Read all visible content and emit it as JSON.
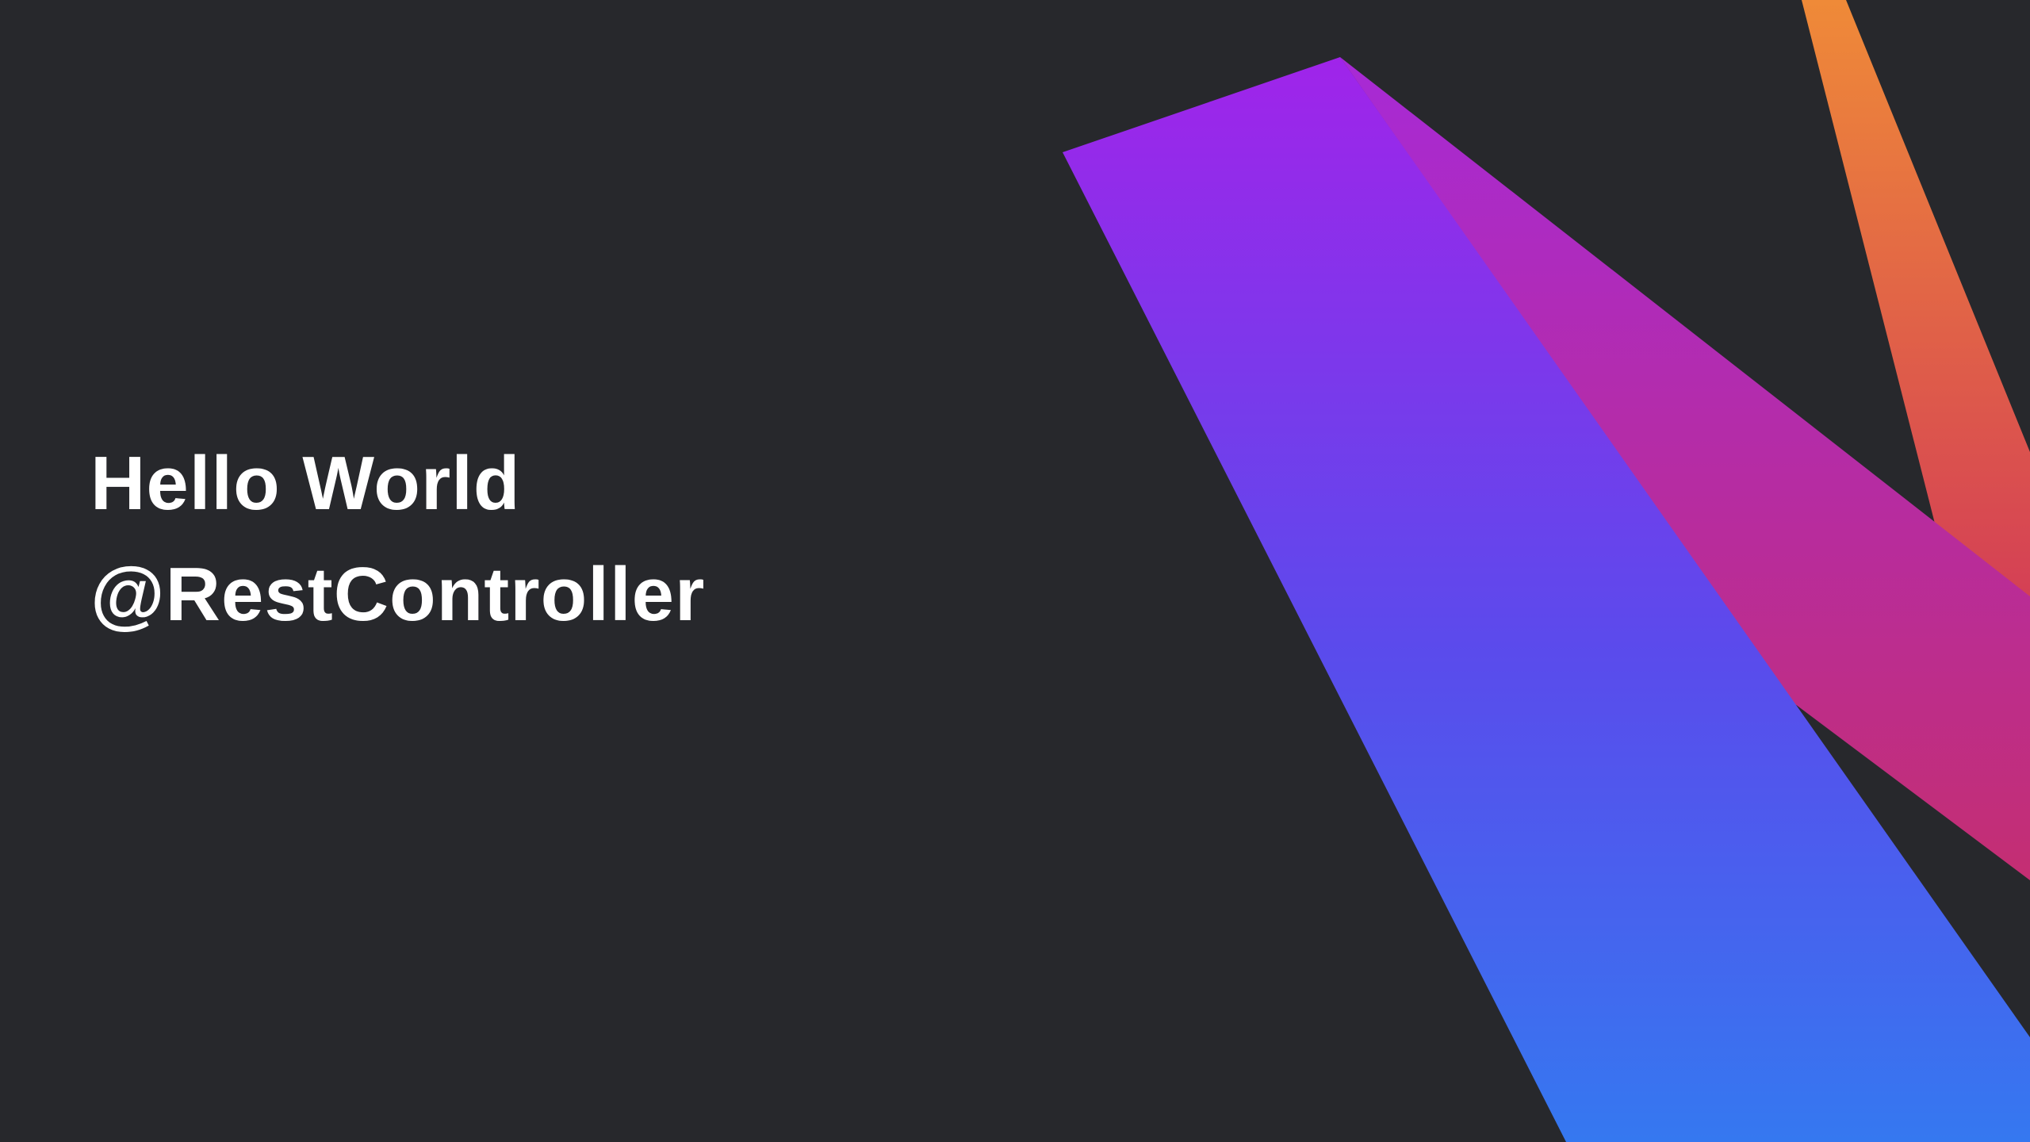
{
  "slide": {
    "title_line_1": "Hello World",
    "title_line_2": "@RestController"
  },
  "colors": {
    "background": "#27282c",
    "text": "#ffffff",
    "stripe_main_top": "#a024ea",
    "stripe_main_bottom": "#3578f0",
    "stripe_pink_top": "#a72ad6",
    "stripe_pink_bottom": "#c42e72",
    "stripe_orange_top": "#ef8a38",
    "stripe_orange_bottom": "#d43f55"
  },
  "decorations": [
    "kotlin-stripe-orange",
    "kotlin-stripe-pink",
    "kotlin-stripe-blue-purple"
  ]
}
